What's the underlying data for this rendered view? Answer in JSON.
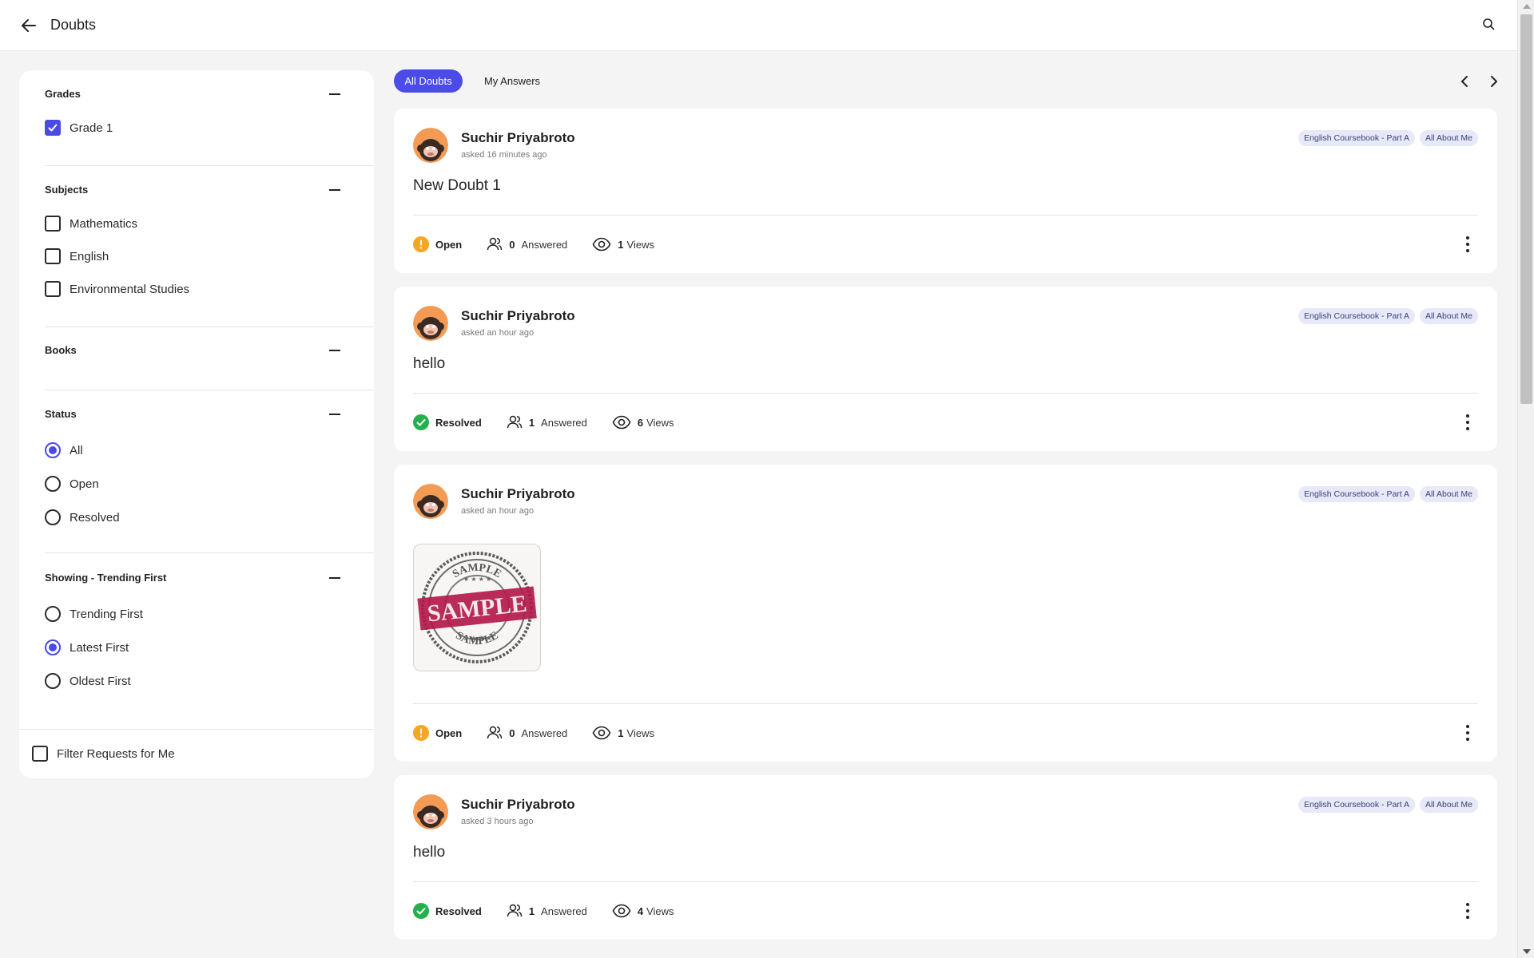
{
  "header": {
    "title": "Doubts"
  },
  "filters": {
    "grades": {
      "title": "Grades",
      "options": [
        {
          "label": "Grade 1",
          "checked": true
        }
      ]
    },
    "subjects": {
      "title": "Subjects",
      "options": [
        {
          "label": "Mathematics",
          "checked": false
        },
        {
          "label": "English",
          "checked": false
        },
        {
          "label": "Environmental Studies",
          "checked": false
        }
      ]
    },
    "books": {
      "title": "Books"
    },
    "status": {
      "title": "Status",
      "options": [
        {
          "label": "All",
          "selected": true
        },
        {
          "label": "Open",
          "selected": false
        },
        {
          "label": "Resolved",
          "selected": false
        }
      ]
    },
    "sort": {
      "title": "Showing - Trending First",
      "options": [
        {
          "label": "Trending First",
          "selected": false
        },
        {
          "label": "Latest First",
          "selected": true
        },
        {
          "label": "Oldest First",
          "selected": false
        }
      ]
    },
    "requests": {
      "label": "Filter Requests for Me",
      "checked": false
    }
  },
  "tabs": [
    {
      "label": "All Doubts",
      "active": true
    },
    {
      "label": "My Answers",
      "active": false
    }
  ],
  "colors": {
    "accent": "#4b4bea",
    "open": "#f5a623",
    "resolved": "#22b14c"
  },
  "doubts": [
    {
      "author": "Suchir Priyabroto",
      "asked": "asked 16 minutes ago",
      "text": "New Doubt 1",
      "tags": [
        "English Coursebook - Part A",
        "All About Me"
      ],
      "status": "Open",
      "answered_count": "0",
      "answered_label": "Answered",
      "views_count": "1",
      "views_label": "Views"
    },
    {
      "author": "Suchir Priyabroto",
      "asked": "asked an hour ago",
      "text": "hello",
      "tags": [
        "English Coursebook - Part A",
        "All About Me"
      ],
      "status": "Resolved",
      "answered_count": "1",
      "answered_label": "Answered",
      "views_count": "6",
      "views_label": "Views"
    },
    {
      "author": "Suchir Priyabroto",
      "asked": "asked an hour ago",
      "text": "",
      "attachment": {
        "stamp_word": "SAMPLE"
      },
      "tags": [
        "English Coursebook - Part A",
        "All About Me"
      ],
      "status": "Open",
      "answered_count": "0",
      "answered_label": "Answered",
      "views_count": "1",
      "views_label": "Views"
    },
    {
      "author": "Suchir Priyabroto",
      "asked": "asked 3 hours ago",
      "text": "hello",
      "tags": [
        "English Coursebook - Part A",
        "All About Me"
      ],
      "status": "Resolved",
      "answered_count": "1",
      "answered_label": "Answered",
      "views_count": "4",
      "views_label": "Views"
    }
  ]
}
